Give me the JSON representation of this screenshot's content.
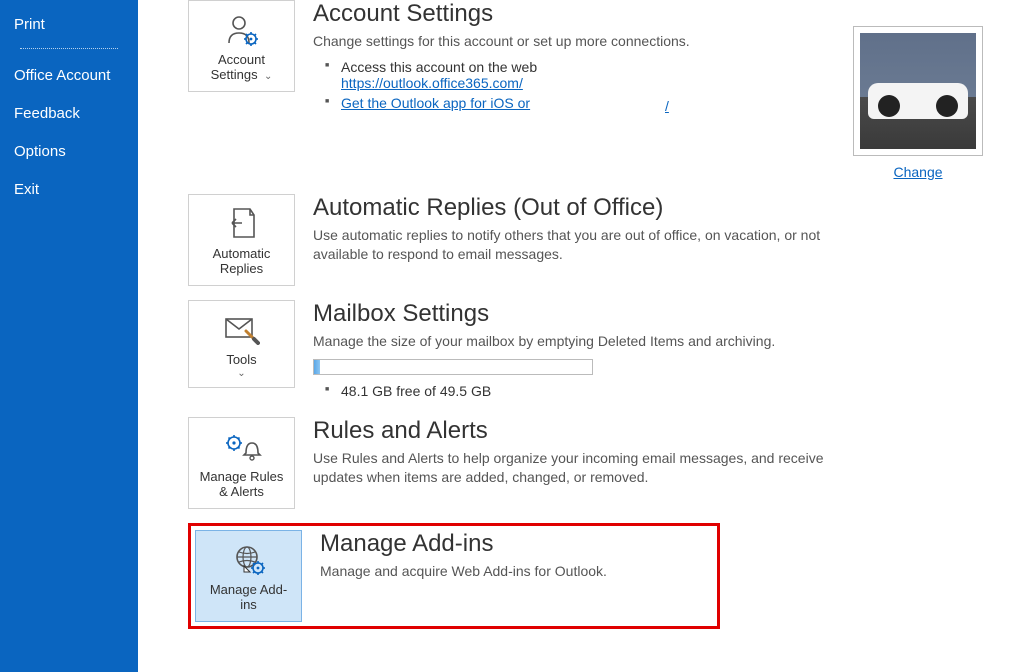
{
  "sidebar": {
    "items": [
      {
        "label": "Print"
      },
      {
        "label": "Office Account"
      },
      {
        "label": "Feedback"
      },
      {
        "label": "Options"
      },
      {
        "label": "Exit"
      }
    ]
  },
  "account": {
    "tile_label_line1": "Account",
    "tile_label_line2": "Settings",
    "title": "Account Settings",
    "desc": "Change settings for this account or set up more connections.",
    "bullet1_text": "Access this account on the web",
    "bullet1_link": "https://outlook.office365.com/",
    "bullet2_link": "Get the Outlook app for iOS or",
    "orphan_link_char": "/",
    "change": "Change"
  },
  "autoreply": {
    "tile_line1": "Automatic",
    "tile_line2": "Replies",
    "title": "Automatic Replies (Out of Office)",
    "desc": "Use automatic replies to notify others that you are out of office, on vacation, or not available to respond to email messages."
  },
  "mailbox": {
    "tile_label": "Tools",
    "title": "Mailbox Settings",
    "desc": "Manage the size of your mailbox by emptying Deleted Items and archiving.",
    "free_text": "48.1 GB free of 49.5 GB"
  },
  "rules": {
    "tile_line1": "Manage Rules",
    "tile_line2": "& Alerts",
    "title": "Rules and Alerts",
    "desc": "Use Rules and Alerts to help organize your incoming email messages, and receive updates when items are added, changed, or removed."
  },
  "addins": {
    "tile_line1": "Manage Add-",
    "tile_line2": "ins",
    "title": "Manage Add-ins",
    "desc": "Manage and acquire Web Add-ins for Outlook."
  }
}
